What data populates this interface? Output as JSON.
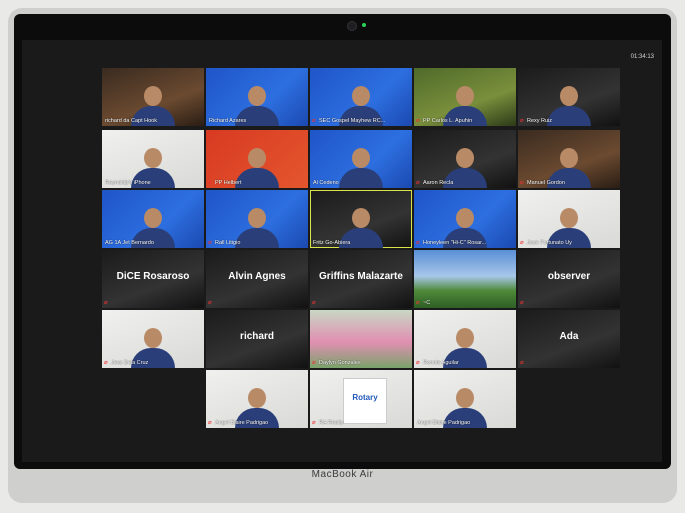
{
  "device": {
    "label": "MacBook Air"
  },
  "meeting": {
    "clock": "01:34:13"
  },
  "participants": [
    {
      "name": "richard da Capt Hook",
      "kind": "video",
      "bg": "room",
      "muted": false,
      "display_text": ""
    },
    {
      "name": "Richard Azares",
      "kind": "video",
      "bg": "rotary",
      "muted": false,
      "display_text": ""
    },
    {
      "name": "SEC Gospel Mayhew RC...",
      "kind": "video",
      "bg": "rotary",
      "muted": true,
      "display_text": ""
    },
    {
      "name": "PP Carlos L. Apuhin",
      "kind": "video",
      "bg": "green",
      "muted": true,
      "display_text": ""
    },
    {
      "name": "Rexy Ruiz",
      "kind": "video",
      "bg": "dark",
      "muted": true,
      "display_text": ""
    },
    {
      "name": "Reynaldp's iPhone",
      "kind": "video",
      "bg": "white",
      "muted": false,
      "display_text": ""
    },
    {
      "name": "PP Helbert",
      "kind": "video",
      "bg": "red",
      "muted": true,
      "display_text": ""
    },
    {
      "name": "Al Cedeno",
      "kind": "video",
      "bg": "rotary",
      "muted": false,
      "display_text": ""
    },
    {
      "name": "Aaron Recla",
      "kind": "video",
      "bg": "dark",
      "muted": true,
      "display_text": ""
    },
    {
      "name": "Manuel Gordon",
      "kind": "video",
      "bg": "room",
      "muted": true,
      "display_text": ""
    },
    {
      "name": "AG 1A Jet Bernardo",
      "kind": "video",
      "bg": "rotary",
      "muted": false,
      "display_text": ""
    },
    {
      "name": "Rall Litigio",
      "kind": "video",
      "bg": "rotary",
      "muted": true,
      "display_text": ""
    },
    {
      "name": "Fritz Go-Abiera",
      "kind": "video",
      "bg": "dark",
      "muted": false,
      "active": true,
      "display_text": ""
    },
    {
      "name": "Honeyleen \"Hi-C\" Rosar...",
      "kind": "video",
      "bg": "rotary",
      "muted": true,
      "display_text": ""
    },
    {
      "name": "Jose Fortunato Uy",
      "kind": "video",
      "bg": "white",
      "muted": true,
      "display_text": ""
    },
    {
      "name": "",
      "kind": "name",
      "bg": "dark",
      "muted": true,
      "display_text": "DiCE Rosaroso"
    },
    {
      "name": "",
      "kind": "name",
      "bg": "dark",
      "muted": true,
      "display_text": "Alvin Agnes"
    },
    {
      "name": "",
      "kind": "name",
      "bg": "dark",
      "muted": true,
      "display_text": "Griffins Malazarte"
    },
    {
      "name": "~C",
      "kind": "image",
      "bg": "mountain",
      "muted": true,
      "display_text": ""
    },
    {
      "name": "",
      "kind": "name",
      "bg": "dark",
      "muted": true,
      "display_text": "observer"
    },
    {
      "name": "Jess Dela Cruz",
      "kind": "video",
      "bg": "white",
      "muted": true,
      "display_text": ""
    },
    {
      "name": "",
      "kind": "name",
      "bg": "dark",
      "muted": false,
      "display_text": "richard"
    },
    {
      "name": "Daylyn Gonzales",
      "kind": "image",
      "bg": "flowers",
      "muted": true,
      "display_text": ""
    },
    {
      "name": "Ronnie Aguilar",
      "kind": "video",
      "bg": "white",
      "muted": true,
      "display_text": ""
    },
    {
      "name": "",
      "kind": "name",
      "bg": "dark",
      "muted": true,
      "display_text": "Ada"
    },
    {
      "name": "Angel Blaire Padrigao",
      "kind": "image",
      "bg": "white",
      "muted": true,
      "display_text": ""
    },
    {
      "name": "RA Realty",
      "kind": "logo",
      "bg": "white",
      "muted": true,
      "display_text": "Rotary"
    },
    {
      "name": "Angel Blaire Padrigao",
      "kind": "image",
      "bg": "white",
      "muted": false,
      "display_text": ""
    }
  ],
  "icons": {
    "mic_muted": "mic-muted-icon"
  },
  "colors": {
    "active_speaker": "#d9e34a",
    "muted_icon": "#e33333",
    "rotary_blue": "#1f58b8"
  }
}
